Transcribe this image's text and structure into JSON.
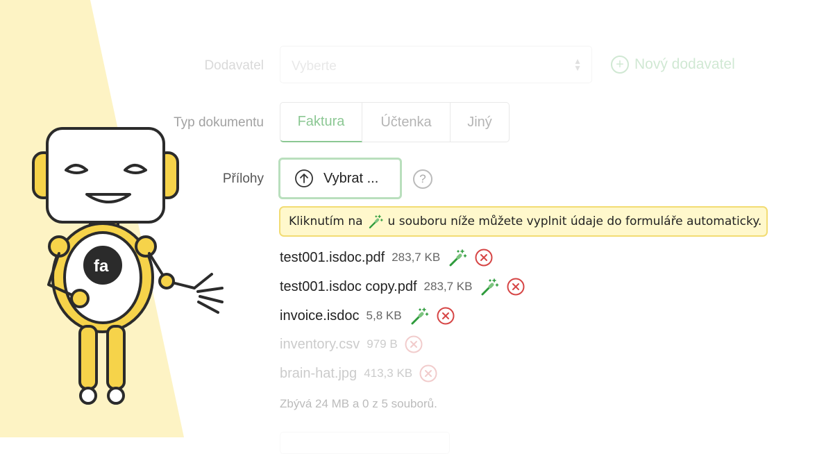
{
  "form": {
    "supplier": {
      "label": "Dodavatel",
      "placeholder": "Vyberte",
      "new_supplier": "Nový dodavatel"
    },
    "doc_type": {
      "label": "Typ dokumentu",
      "options": [
        "Faktura",
        "Účtenka",
        "Jiný"
      ],
      "selected": "Faktura"
    },
    "attachments": {
      "label": "Přílohy",
      "upload_button": "Vybrat ...",
      "help": "?",
      "info_before": "Kliknutím na",
      "info_after": "u souboru níže můžete vyplnit údaje do formuláře automaticky.",
      "files": [
        {
          "name": "test001.isdoc.pdf",
          "size": "283,7 KB",
          "autofill": true
        },
        {
          "name": "test001.isdoc copy.pdf",
          "size": "283,7 KB",
          "autofill": true
        },
        {
          "name": "invoice.isdoc",
          "size": "5,8 KB",
          "autofill": true
        },
        {
          "name": "inventory.csv",
          "size": "979 B",
          "autofill": false
        },
        {
          "name": "brain-hat.jpg",
          "size": "413,3 KB",
          "autofill": false
        }
      ],
      "remaining": "Zbývá 24 MB a 0 z 5 souborů."
    }
  },
  "icons": {
    "upload": "upload-arrow-icon",
    "wand": "magic-wand-icon",
    "remove": "close-circle-icon",
    "plus": "plus-circle-icon",
    "robot_badge": "fa"
  },
  "colors": {
    "accent_green": "#2e9b3c",
    "remove_red": "#d64545",
    "info_bg": "#fff8cc",
    "info_border": "#f2dc73",
    "stripe_yellow": "#fdf3c4"
  }
}
